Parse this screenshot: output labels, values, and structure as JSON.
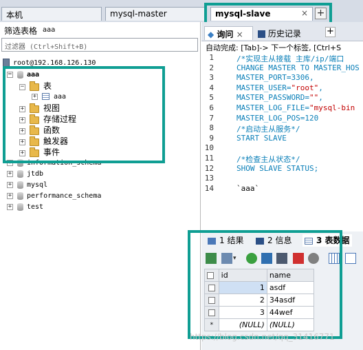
{
  "tabs": {
    "local": "本机",
    "master": "mysql-master",
    "slave": "mysql-slave",
    "close_glyph": "×",
    "add_glyph": "+"
  },
  "sidebar": {
    "filter_label": "筛选表格",
    "filter_value": "aaa",
    "filter_placeholder": "过滤器 (Ctrl+Shift+B)",
    "server": "root@192.168.126.130",
    "db_aaa": "aaa",
    "node_tables": "表",
    "table_aaa": "aaa",
    "node_views": "视图",
    "node_procs": "存储过程",
    "node_funcs": "函数",
    "node_triggers": "触发器",
    "node_events": "事件",
    "db_info": "information_schema",
    "db_jtdb": "jtdb",
    "db_mysql": "mysql",
    "db_perf": "performance_schema",
    "db_test": "test"
  },
  "editor": {
    "tab_query": "询问",
    "tab_history": "历史记录",
    "close_glyph": "×",
    "add_glyph": "+",
    "autocomplete": "自动完成: [Tab]-> 下一个标签, [Ctrl+S",
    "lines": [
      {
        "n": "1",
        "t": "/*实现主从接载 主库/ip/端口",
        "c": "cm"
      },
      {
        "n": "2",
        "t": "CHANGE MASTER TO MASTER_HOS",
        "c": "kw"
      },
      {
        "n": "3",
        "t": "MASTER_PORT=3306,",
        "c": "kw"
      },
      {
        "n": "4",
        "t": "MASTER_USER=\"root\",",
        "c": "kw"
      },
      {
        "n": "5",
        "t": "MASTER_PASSWORD=\"\",",
        "c": "kw"
      },
      {
        "n": "6",
        "t": "MASTER_LOG_FILE=\"mysql-bin",
        "c": "kw"
      },
      {
        "n": "7",
        "t": "MASTER_LOG_POS=120",
        "c": "kw"
      },
      {
        "n": "8",
        "t": "/*启动主从服务*/",
        "c": "cm"
      },
      {
        "n": "9",
        "t": "START SLAVE",
        "c": "kw"
      },
      {
        "n": "10",
        "t": "",
        "c": "pl"
      },
      {
        "n": "11",
        "t": "/*检查主从状态*/",
        "c": "cm"
      },
      {
        "n": "12",
        "t": "SHOW SLAVE STATUS;",
        "c": "kw"
      },
      {
        "n": "13",
        "t": "",
        "c": "pl"
      },
      {
        "n": "14",
        "t": "`aaa`",
        "c": "pl"
      }
    ]
  },
  "results": {
    "tab1": "1 结果",
    "tab2": "2 信息",
    "tab3": "3 表数据",
    "col_id": "id",
    "col_name": "name",
    "rows": [
      {
        "id": "1",
        "name": "asdf"
      },
      {
        "id": "2",
        "name": "34asdf"
      },
      {
        "id": "3",
        "name": "44wef"
      }
    ],
    "null_id": "(NULL)",
    "null_name": "(NULL)",
    "new_row_marker": "*"
  },
  "watermark": "https://blog.csdn.net/qq_31416771",
  "colors": {
    "highlight": "#0f9e93",
    "keyword": "#0a7fb8",
    "string": "#c20000"
  }
}
